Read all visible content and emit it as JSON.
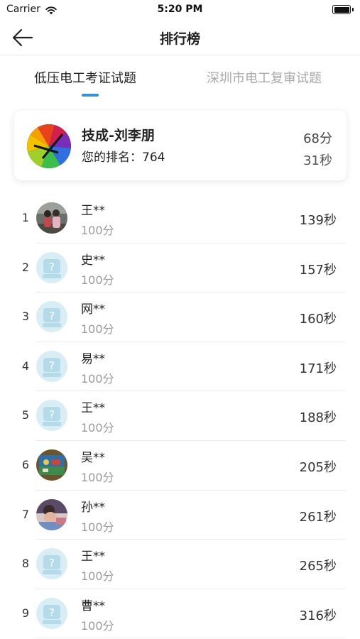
{
  "status_bar": {
    "carrier": "Carrier",
    "time": "5:20 PM"
  },
  "nav": {
    "title": "排行榜"
  },
  "tabs": [
    {
      "label": "低压电工考证试题",
      "active": true
    },
    {
      "label": "深圳市电工复审试题",
      "active": false
    }
  ],
  "my_record": {
    "name": "技成-刘李朋",
    "rank_label": "您的排名：",
    "rank": "764",
    "score": "68分",
    "time": "31秒"
  },
  "ranking": [
    {
      "rank": "1",
      "name": "王**",
      "score": "100分",
      "time": "139秒",
      "avatar": "photo-couple"
    },
    {
      "rank": "2",
      "name": "史**",
      "score": "100分",
      "time": "157秒",
      "avatar": "default-avatar"
    },
    {
      "rank": "3",
      "name": "网**",
      "score": "100分",
      "time": "160秒",
      "avatar": "default-avatar"
    },
    {
      "rank": "4",
      "name": "易**",
      "score": "100分",
      "time": "171秒",
      "avatar": "default-avatar"
    },
    {
      "rank": "5",
      "name": "王**",
      "score": "100分",
      "time": "188秒",
      "avatar": "default-avatar"
    },
    {
      "rank": "6",
      "name": "吴**",
      "score": "100分",
      "time": "205秒",
      "avatar": "photo-painting"
    },
    {
      "rank": "7",
      "name": "孙**",
      "score": "100分",
      "time": "261秒",
      "avatar": "photo-child"
    },
    {
      "rank": "8",
      "name": "王**",
      "score": "100分",
      "time": "265秒",
      "avatar": "default-avatar"
    },
    {
      "rank": "9",
      "name": "曹**",
      "score": "100分",
      "time": "316秒",
      "avatar": "default-avatar"
    }
  ],
  "colors": {
    "accent": "#3a8fd0",
    "muted_text": "#9a9a9a",
    "inactive_tab": "#a9a9a9"
  }
}
